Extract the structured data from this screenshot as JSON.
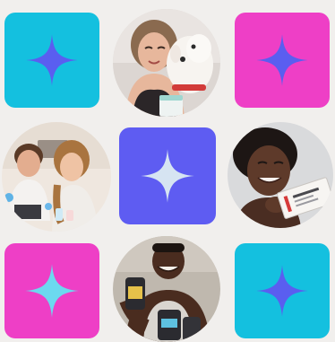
{
  "colors": {
    "background": "#f1efed",
    "cyan": "#14c0df",
    "magenta": "#ee3fc6",
    "indigo": "#5e5cf2",
    "star_indigo": "#5a5ef0",
    "star_cyan": "#6cd9ef",
    "star_pale": "#d6e4f2"
  },
  "tiles": [
    {
      "bg": "cyan",
      "star": "star_indigo",
      "icon": "sparkle-icon"
    },
    {
      "bg": "magenta",
      "star": "star_indigo",
      "icon": "sparkle-icon"
    },
    {
      "bg": "indigo",
      "star": "star_pale",
      "icon": "sparkle-icon"
    },
    {
      "bg": "magenta",
      "star": "star_cyan",
      "icon": "sparkle-icon"
    },
    {
      "bg": "cyan",
      "star": "star_indigo",
      "icon": "sparkle-icon"
    }
  ],
  "photos": [
    {
      "subject": "woman-with-dog"
    },
    {
      "subject": "kids-science-experiment"
    },
    {
      "subject": "smiling-woman-with-product-box"
    },
    {
      "subject": "man-with-product-bottles"
    }
  ]
}
